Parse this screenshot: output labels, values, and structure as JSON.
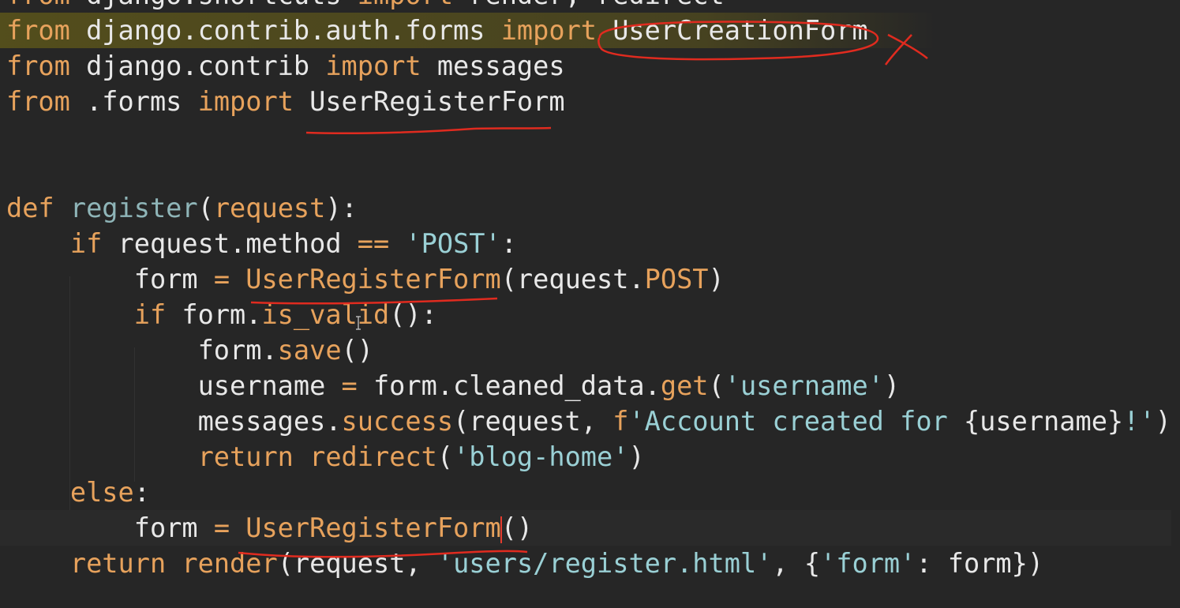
{
  "lines": [
    {
      "segments": [
        {
          "t": "from",
          "c": "kw"
        },
        {
          "t": " django.shortcuts ",
          "c": "txt"
        },
        {
          "t": "import",
          "c": "kw"
        },
        {
          "t": " render, redirect",
          "c": "txt"
        }
      ]
    },
    {
      "segments": [
        {
          "t": "from",
          "c": "kw"
        },
        {
          "t": " django.contrib.auth.forms ",
          "c": "txt"
        },
        {
          "t": "import",
          "c": "kw"
        },
        {
          "t": " UserCreationForm",
          "c": "txt"
        }
      ]
    },
    {
      "segments": [
        {
          "t": "from",
          "c": "kw"
        },
        {
          "t": " django.contrib ",
          "c": "txt"
        },
        {
          "t": "import",
          "c": "kw"
        },
        {
          "t": " messages",
          "c": "txt"
        }
      ]
    },
    {
      "segments": [
        {
          "t": "from",
          "c": "kw"
        },
        {
          "t": " .forms ",
          "c": "txt"
        },
        {
          "t": "import",
          "c": "kw"
        },
        {
          "t": " UserRegisterForm",
          "c": "txt"
        }
      ]
    },
    {
      "segments": []
    },
    {
      "segments": []
    },
    {
      "segments": [
        {
          "t": "def",
          "c": "kw"
        },
        {
          "t": " ",
          "c": "txt"
        },
        {
          "t": "register",
          "c": "fn"
        },
        {
          "t": "(",
          "c": "txt"
        },
        {
          "t": "request",
          "c": "var"
        },
        {
          "t": "):",
          "c": "txt"
        }
      ]
    },
    {
      "segments": [
        {
          "t": "    ",
          "c": "txt"
        },
        {
          "t": "if",
          "c": "kw"
        },
        {
          "t": " request.method ",
          "c": "txt"
        },
        {
          "t": "==",
          "c": "kw"
        },
        {
          "t": " ",
          "c": "txt"
        },
        {
          "t": "'POST'",
          "c": "str"
        },
        {
          "t": ":",
          "c": "txt"
        }
      ]
    },
    {
      "segments": [
        {
          "t": "        form ",
          "c": "txt"
        },
        {
          "t": "=",
          "c": "kw"
        },
        {
          "t": " ",
          "c": "txt"
        },
        {
          "t": "UserRegisterForm",
          "c": "var"
        },
        {
          "t": "(request.",
          "c": "txt"
        },
        {
          "t": "POST",
          "c": "var"
        },
        {
          "t": ")",
          "c": "txt"
        }
      ]
    },
    {
      "segments": [
        {
          "t": "        ",
          "c": "txt"
        },
        {
          "t": "if",
          "c": "kw"
        },
        {
          "t": " form.",
          "c": "txt"
        },
        {
          "t": "is_valid",
          "c": "meth"
        },
        {
          "t": "():",
          "c": "txt"
        }
      ]
    },
    {
      "segments": [
        {
          "t": "            form.",
          "c": "txt"
        },
        {
          "t": "save",
          "c": "meth"
        },
        {
          "t": "()",
          "c": "txt"
        }
      ]
    },
    {
      "segments": [
        {
          "t": "            username ",
          "c": "txt"
        },
        {
          "t": "=",
          "c": "kw"
        },
        {
          "t": " form.cleaned_data.",
          "c": "txt"
        },
        {
          "t": "get",
          "c": "meth"
        },
        {
          "t": "(",
          "c": "txt"
        },
        {
          "t": "'username'",
          "c": "str"
        },
        {
          "t": ")",
          "c": "txt"
        }
      ]
    },
    {
      "segments": [
        {
          "t": "            messages.",
          "c": "txt"
        },
        {
          "t": "success",
          "c": "meth"
        },
        {
          "t": "(request, ",
          "c": "txt"
        },
        {
          "t": "f",
          "c": "kw"
        },
        {
          "t": "'Account created for ",
          "c": "str"
        },
        {
          "t": "{username}",
          "c": "txt"
        },
        {
          "t": "!'",
          "c": "str"
        },
        {
          "t": ")",
          "c": "txt"
        }
      ]
    },
    {
      "segments": [
        {
          "t": "            ",
          "c": "txt"
        },
        {
          "t": "return",
          "c": "kw"
        },
        {
          "t": " ",
          "c": "txt"
        },
        {
          "t": "redirect",
          "c": "meth"
        },
        {
          "t": "(",
          "c": "txt"
        },
        {
          "t": "'blog-home'",
          "c": "str"
        },
        {
          "t": ")",
          "c": "txt"
        }
      ]
    },
    {
      "segments": [
        {
          "t": "    ",
          "c": "txt"
        },
        {
          "t": "else",
          "c": "kw"
        },
        {
          "t": ":",
          "c": "txt"
        }
      ]
    },
    {
      "segments": [
        {
          "t": "        form ",
          "c": "txt"
        },
        {
          "t": "=",
          "c": "kw"
        },
        {
          "t": " ",
          "c": "txt"
        },
        {
          "t": "UserRegisterForm",
          "c": "var"
        },
        {
          "t": "()",
          "c": "txt"
        }
      ]
    },
    {
      "segments": [
        {
          "t": "    ",
          "c": "txt"
        },
        {
          "t": "return",
          "c": "kw"
        },
        {
          "t": " ",
          "c": "txt"
        },
        {
          "t": "render",
          "c": "meth"
        },
        {
          "t": "(request, ",
          "c": "txt"
        },
        {
          "t": "'users/register.html'",
          "c": "str"
        },
        {
          "t": ", {",
          "c": "txt"
        },
        {
          "t": "'form'",
          "c": "str"
        },
        {
          "t": ": form})",
          "c": "txt"
        }
      ]
    }
  ],
  "highlighted_line_index": 1,
  "current_line_index": 15,
  "colors": {
    "background": "#262626",
    "keyword": "#e7a25c",
    "string": "#9ad0d5",
    "function": "#8fb5b8",
    "text": "#e8e8e8",
    "highlight": "#787014",
    "annotation": "#e53c2e"
  }
}
